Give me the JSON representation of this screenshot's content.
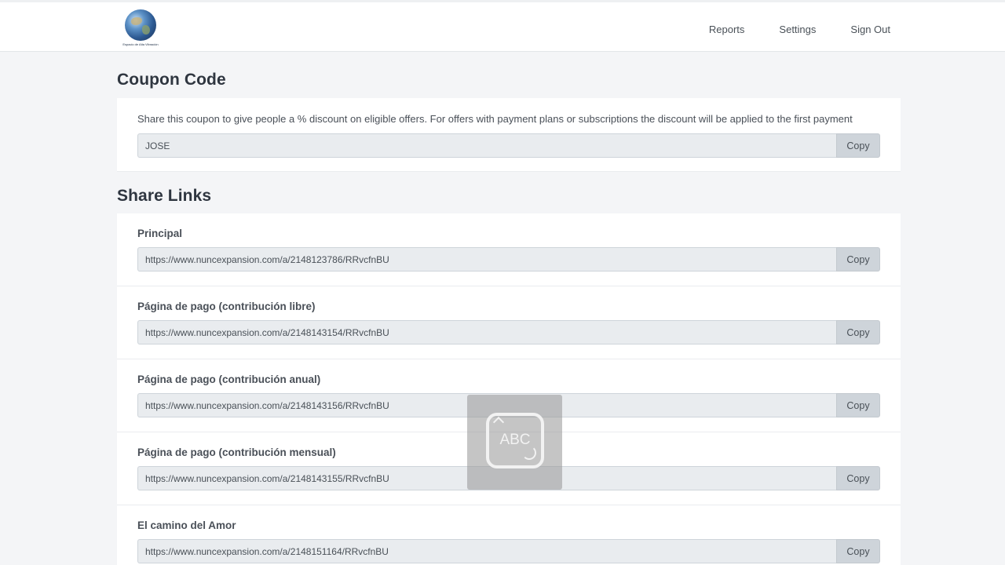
{
  "logo": {
    "alt_text": "Espacio de Alta Vibración"
  },
  "nav": {
    "items": [
      {
        "label": "Reports"
      },
      {
        "label": "Settings"
      },
      {
        "label": "Sign Out"
      }
    ]
  },
  "coupon": {
    "title": "Coupon Code",
    "description": "Share this coupon to give people a % discount on eligible offers. For offers with payment plans or subscriptions the discount will be applied to the first payment",
    "code": "JOSE",
    "copy_label": "Copy"
  },
  "share_links": {
    "title": "Share Links",
    "items": [
      {
        "label": "Principal",
        "url": "https://www.nuncexpansion.com/a/2148123786/RRvcfnBU",
        "copy_label": "Copy"
      },
      {
        "label": "Página de pago (contribución libre)",
        "url": "https://www.nuncexpansion.com/a/2148143154/RRvcfnBU",
        "copy_label": "Copy"
      },
      {
        "label": "Página de pago (contribución anual)",
        "url": "https://www.nuncexpansion.com/a/2148143156/RRvcfnBU",
        "copy_label": "Copy"
      },
      {
        "label": "Página de pago (contribución mensual)",
        "url": "https://www.nuncexpansion.com/a/2148143155/RRvcfnBU",
        "copy_label": "Copy"
      },
      {
        "label": "El camino del Amor",
        "url": "https://www.nuncexpansion.com/a/2148151164/RRvcfnBU",
        "copy_label": "Copy"
      }
    ]
  },
  "overlay": {
    "text": "ABC",
    "icon": "keyboard-input-icon"
  }
}
